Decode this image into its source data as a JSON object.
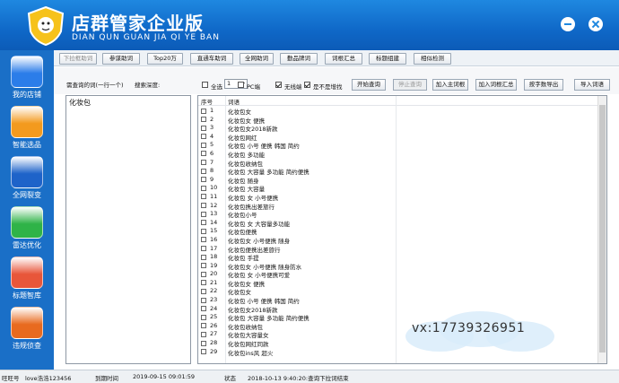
{
  "window": {
    "title": "店群管家企业版",
    "subtitle": "DIAN QUN GUAN JIA QI YE BAN"
  },
  "sidebar": {
    "items": [
      {
        "label": "我的店铺",
        "icon": "user-profile-icon",
        "color": "#2b7de9"
      },
      {
        "label": "智能选品",
        "icon": "hand-pointer-icon",
        "color": "#f39a1e"
      },
      {
        "label": "全网裂变",
        "icon": "upload-arrow-icon",
        "color": "#1e63c9"
      },
      {
        "label": "雷达优化",
        "icon": "radar-circle-icon",
        "color": "#2fb348"
      },
      {
        "label": "标题智库",
        "icon": "folder-plus-icon",
        "color": "#e8563a"
      },
      {
        "label": "违规侦查",
        "icon": "magnifier-person-icon",
        "color": "#e86a1f"
      }
    ]
  },
  "toolbar": {
    "buttons": [
      {
        "label": "下拉框助词",
        "disabled": true
      },
      {
        "label": "参谋助词",
        "disabled": false
      },
      {
        "label": "Top20万",
        "disabled": false
      },
      {
        "label": "直通车助词",
        "disabled": false
      },
      {
        "label": "全网助词",
        "disabled": false
      },
      {
        "label": "勤品牌词",
        "disabled": false
      },
      {
        "label": "词根汇总",
        "disabled": false
      },
      {
        "label": "标题组建",
        "disabled": false
      },
      {
        "label": "相似检测",
        "disabled": false
      }
    ]
  },
  "controls": {
    "query_label": "需查询的词(一行一个)",
    "depth_label": "搜索深度:",
    "depth_value": "1",
    "checkboxes": [
      {
        "label": "全选",
        "checked": false
      },
      {
        "label": "PC端",
        "checked": false
      },
      {
        "label": "无线端",
        "checked": true
      },
      {
        "label": "是不是增找",
        "checked": true
      }
    ],
    "buttons": [
      {
        "label": "开始查询",
        "disabled": false
      },
      {
        "label": "停止查询",
        "disabled": true
      },
      {
        "label": "加入主词根",
        "disabled": false
      },
      {
        "label": "加入词根汇总",
        "disabled": false
      },
      {
        "label": "按字数导出",
        "disabled": false
      },
      {
        "label": "导入词语",
        "disabled": false
      }
    ]
  },
  "query_input": {
    "value": "化妆包"
  },
  "results": {
    "headers": {
      "index": "序号",
      "keyword": "词语"
    },
    "rows": [
      {
        "n": "1",
        "kw": "化妆包女"
      },
      {
        "n": "2",
        "kw": "化妆包女 便携"
      },
      {
        "n": "3",
        "kw": "化妆包女2018新款"
      },
      {
        "n": "4",
        "kw": "化妆包网红"
      },
      {
        "n": "5",
        "kw": "化妆包 小号 便携 韩国 简约"
      },
      {
        "n": "6",
        "kw": "化妆包 多功能"
      },
      {
        "n": "7",
        "kw": "化妆包收纳包"
      },
      {
        "n": "8",
        "kw": "化妆包 大容量 多功能 简约便携"
      },
      {
        "n": "9",
        "kw": "化妆包 随身"
      },
      {
        "n": "10",
        "kw": "化妆包 大容量"
      },
      {
        "n": "11",
        "kw": "化妆包 女 小号便携"
      },
      {
        "n": "12",
        "kw": "化妆包携出差旅行"
      },
      {
        "n": "13",
        "kw": "化妆包小号"
      },
      {
        "n": "14",
        "kw": "化妆包 女 大容量多功能"
      },
      {
        "n": "15",
        "kw": "化妆包便携"
      },
      {
        "n": "16",
        "kw": "化妆包女 小号便携 随身"
      },
      {
        "n": "17",
        "kw": "化妆包便携出差旅行"
      },
      {
        "n": "18",
        "kw": "化妆包 手提"
      },
      {
        "n": "19",
        "kw": "化妆包女 小号便携 随身防水"
      },
      {
        "n": "20",
        "kw": "化妆包 女 小号便携可爱"
      },
      {
        "n": "21",
        "kw": "化妆包女 便携"
      },
      {
        "n": "22",
        "kw": "化妆包女"
      },
      {
        "n": "23",
        "kw": "化妆包 小号 便携 韩国 简约"
      },
      {
        "n": "24",
        "kw": "化妆包女2018新款"
      },
      {
        "n": "25",
        "kw": "化妆包 大容量 多功能 简约便携"
      },
      {
        "n": "26",
        "kw": "化妆包收纳包"
      },
      {
        "n": "27",
        "kw": "化妆包大容量女"
      },
      {
        "n": "28",
        "kw": "化妆包网红同款"
      },
      {
        "n": "29",
        "kw": "化妆包ins风 超火"
      }
    ]
  },
  "watermark": {
    "text": "vx:17739326951"
  },
  "statusbar": {
    "account_label": "旺旺号",
    "account_value": "love浩浩123456",
    "expire_label": "到期时间",
    "expire_value": "2019-09-15 09:01:59",
    "state_label": "状态",
    "state_value": "2018-10-13 9:40:20:查询下拉词结束"
  },
  "colors": {
    "title_bar": "#1477d6",
    "sidebar": "#1a6fc7",
    "panel_bg": "#f6f7f9"
  }
}
